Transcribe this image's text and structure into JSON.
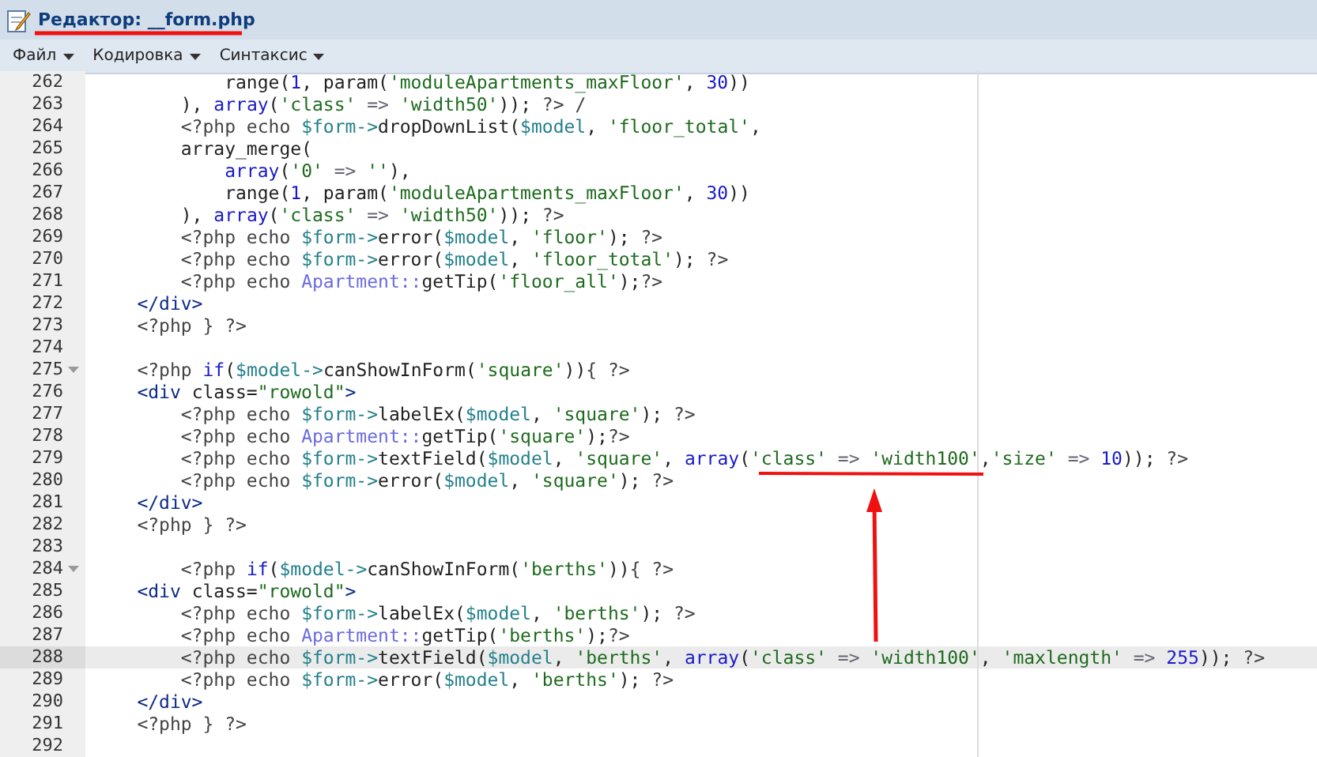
{
  "window": {
    "title": "Редактор: __form.php"
  },
  "menu": [
    {
      "label": "Файл"
    },
    {
      "label": "Кодировка"
    },
    {
      "label": "Синтаксис"
    }
  ],
  "editor": {
    "lines": [
      {
        "number": "262",
        "current": false,
        "foldable": false,
        "tokens": [
          {
            "kind": "plain",
            "text": "            range("
          },
          {
            "kind": "number",
            "text": "1"
          },
          {
            "kind": "plain",
            "text": ", param("
          },
          {
            "kind": "string",
            "text": "'moduleApartments_maxFloor'"
          },
          {
            "kind": "plain",
            "text": ", "
          },
          {
            "kind": "number",
            "text": "30"
          },
          {
            "kind": "plain",
            "text": "))"
          }
        ]
      },
      {
        "number": "263",
        "current": false,
        "foldable": false,
        "tokens": [
          {
            "kind": "plain",
            "text": "        ), "
          },
          {
            "kind": "keyword",
            "text": "array"
          },
          {
            "kind": "plain",
            "text": "("
          },
          {
            "kind": "string",
            "text": "'class'"
          },
          {
            "kind": "operator",
            "text": " => "
          },
          {
            "kind": "string",
            "text": "'width50'"
          },
          {
            "kind": "plain",
            "text": "));"
          },
          {
            "kind": "php",
            "text": " ?> /"
          }
        ]
      },
      {
        "number": "264",
        "current": false,
        "foldable": false,
        "tokens": [
          {
            "kind": "php",
            "text": "        <?php echo "
          },
          {
            "kind": "variable",
            "text": "$form->"
          },
          {
            "kind": "plain",
            "text": "dropDownList("
          },
          {
            "kind": "variable",
            "text": "$model"
          },
          {
            "kind": "plain",
            "text": ", "
          },
          {
            "kind": "string",
            "text": "'floor_total'"
          },
          {
            "kind": "plain",
            "text": ","
          }
        ]
      },
      {
        "number": "265",
        "current": false,
        "foldable": false,
        "tokens": [
          {
            "kind": "plain",
            "text": "        array_merge("
          }
        ]
      },
      {
        "number": "266",
        "current": false,
        "foldable": false,
        "tokens": [
          {
            "kind": "keyword",
            "text": "            array"
          },
          {
            "kind": "plain",
            "text": "("
          },
          {
            "kind": "string",
            "text": "'0'"
          },
          {
            "kind": "operator",
            "text": " => "
          },
          {
            "kind": "string",
            "text": "''"
          },
          {
            "kind": "plain",
            "text": "),"
          }
        ]
      },
      {
        "number": "267",
        "current": false,
        "foldable": false,
        "tokens": [
          {
            "kind": "plain",
            "text": "            range("
          },
          {
            "kind": "number",
            "text": "1"
          },
          {
            "kind": "plain",
            "text": ", param("
          },
          {
            "kind": "string",
            "text": "'moduleApartments_maxFloor'"
          },
          {
            "kind": "plain",
            "text": ", "
          },
          {
            "kind": "number",
            "text": "30"
          },
          {
            "kind": "plain",
            "text": "))"
          }
        ]
      },
      {
        "number": "268",
        "current": false,
        "foldable": false,
        "tokens": [
          {
            "kind": "plain",
            "text": "        ), "
          },
          {
            "kind": "keyword",
            "text": "array"
          },
          {
            "kind": "plain",
            "text": "("
          },
          {
            "kind": "string",
            "text": "'class'"
          },
          {
            "kind": "operator",
            "text": " => "
          },
          {
            "kind": "string",
            "text": "'width50'"
          },
          {
            "kind": "plain",
            "text": "));"
          },
          {
            "kind": "php",
            "text": " ?>"
          }
        ]
      },
      {
        "number": "269",
        "current": false,
        "foldable": false,
        "tokens": [
          {
            "kind": "php",
            "text": "        <?php echo "
          },
          {
            "kind": "variable",
            "text": "$form->"
          },
          {
            "kind": "plain",
            "text": "error("
          },
          {
            "kind": "variable",
            "text": "$model"
          },
          {
            "kind": "plain",
            "text": ", "
          },
          {
            "kind": "string",
            "text": "'floor'"
          },
          {
            "kind": "plain",
            "text": ");"
          },
          {
            "kind": "php",
            "text": " ?>"
          }
        ]
      },
      {
        "number": "270",
        "current": false,
        "foldable": false,
        "tokens": [
          {
            "kind": "php",
            "text": "        <?php echo "
          },
          {
            "kind": "variable",
            "text": "$form->"
          },
          {
            "kind": "plain",
            "text": "error("
          },
          {
            "kind": "variable",
            "text": "$model"
          },
          {
            "kind": "plain",
            "text": ", "
          },
          {
            "kind": "string",
            "text": "'floor_total'"
          },
          {
            "kind": "plain",
            "text": ");"
          },
          {
            "kind": "php",
            "text": " ?>"
          }
        ]
      },
      {
        "number": "271",
        "current": false,
        "foldable": false,
        "tokens": [
          {
            "kind": "php",
            "text": "        <?php echo "
          },
          {
            "kind": "class",
            "text": "Apartment::"
          },
          {
            "kind": "plain",
            "text": "getTip("
          },
          {
            "kind": "string",
            "text": "'floor_all'"
          },
          {
            "kind": "plain",
            "text": ");"
          },
          {
            "kind": "php",
            "text": "?>"
          }
        ]
      },
      {
        "number": "272",
        "current": false,
        "foldable": false,
        "tokens": [
          {
            "kind": "tag",
            "text": "    </div>"
          }
        ]
      },
      {
        "number": "273",
        "current": false,
        "foldable": false,
        "tokens": [
          {
            "kind": "php",
            "text": "    <?php } ?>"
          }
        ]
      },
      {
        "number": "274",
        "current": false,
        "foldable": false
      },
      {
        "number": "275",
        "current": false,
        "foldable": true,
        "tokens": [
          {
            "kind": "php",
            "text": "    <?php "
          },
          {
            "kind": "keyword",
            "text": "if"
          },
          {
            "kind": "plain",
            "text": "("
          },
          {
            "kind": "variable",
            "text": "$model->"
          },
          {
            "kind": "plain",
            "text": "canShowInForm("
          },
          {
            "kind": "string",
            "text": "'square'"
          },
          {
            "kind": "plain",
            "text": "))"
          },
          {
            "kind": "php",
            "text": "{ ?>"
          }
        ]
      },
      {
        "number": "276",
        "current": false,
        "foldable": false,
        "tokens": [
          {
            "kind": "tag",
            "text": "    <div"
          },
          {
            "kind": "plain",
            "text": " class="
          },
          {
            "kind": "string",
            "text": "\"rowold\""
          },
          {
            "kind": "tag",
            "text": ">"
          }
        ]
      },
      {
        "number": "277",
        "current": false,
        "foldable": false,
        "tokens": [
          {
            "kind": "php",
            "text": "        <?php echo "
          },
          {
            "kind": "variable",
            "text": "$form->"
          },
          {
            "kind": "plain",
            "text": "labelEx("
          },
          {
            "kind": "variable",
            "text": "$model"
          },
          {
            "kind": "plain",
            "text": ", "
          },
          {
            "kind": "string",
            "text": "'square'"
          },
          {
            "kind": "plain",
            "text": ");"
          },
          {
            "kind": "php",
            "text": " ?>"
          }
        ]
      },
      {
        "number": "278",
        "current": false,
        "foldable": false,
        "tokens": [
          {
            "kind": "php",
            "text": "        <?php echo "
          },
          {
            "kind": "class",
            "text": "Apartment::"
          },
          {
            "kind": "plain",
            "text": "getTip("
          },
          {
            "kind": "string",
            "text": "'square'"
          },
          {
            "kind": "plain",
            "text": ");"
          },
          {
            "kind": "php",
            "text": "?>"
          }
        ]
      },
      {
        "number": "279",
        "current": false,
        "foldable": false,
        "tokens": [
          {
            "kind": "php",
            "text": "        <?php echo "
          },
          {
            "kind": "variable",
            "text": "$form->"
          },
          {
            "kind": "plain",
            "text": "textField("
          },
          {
            "kind": "variable",
            "text": "$model"
          },
          {
            "kind": "plain",
            "text": ", "
          },
          {
            "kind": "string",
            "text": "'square'"
          },
          {
            "kind": "plain",
            "text": ", "
          },
          {
            "kind": "keyword",
            "text": "array"
          },
          {
            "kind": "plain",
            "text": "("
          },
          {
            "kind": "string",
            "text": "'class'"
          },
          {
            "kind": "operator",
            "text": " => "
          },
          {
            "kind": "string",
            "text": "'width100'"
          },
          {
            "kind": "plain",
            "text": ","
          },
          {
            "kind": "string",
            "text": "'size'"
          },
          {
            "kind": "operator",
            "text": " => "
          },
          {
            "kind": "number",
            "text": "10"
          },
          {
            "kind": "plain",
            "text": "));"
          },
          {
            "kind": "php",
            "text": " ?>"
          }
        ]
      },
      {
        "number": "280",
        "current": false,
        "foldable": false,
        "tokens": [
          {
            "kind": "php",
            "text": "        <?php echo "
          },
          {
            "kind": "variable",
            "text": "$form->"
          },
          {
            "kind": "plain",
            "text": "error("
          },
          {
            "kind": "variable",
            "text": "$model"
          },
          {
            "kind": "plain",
            "text": ", "
          },
          {
            "kind": "string",
            "text": "'square'"
          },
          {
            "kind": "plain",
            "text": ");"
          },
          {
            "kind": "php",
            "text": " ?>"
          }
        ]
      },
      {
        "number": "281",
        "current": false,
        "foldable": false,
        "tokens": [
          {
            "kind": "tag",
            "text": "    </div>"
          }
        ]
      },
      {
        "number": "282",
        "current": false,
        "foldable": false,
        "tokens": [
          {
            "kind": "php",
            "text": "    <?php } ?>"
          }
        ]
      },
      {
        "number": "283",
        "current": false,
        "foldable": false
      },
      {
        "number": "284",
        "current": false,
        "foldable": true,
        "tokens": [
          {
            "kind": "php",
            "text": "        <?php "
          },
          {
            "kind": "keyword",
            "text": "if"
          },
          {
            "kind": "plain",
            "text": "("
          },
          {
            "kind": "variable",
            "text": "$model->"
          },
          {
            "kind": "plain",
            "text": "canShowInForm("
          },
          {
            "kind": "string",
            "text": "'berths'"
          },
          {
            "kind": "plain",
            "text": "))"
          },
          {
            "kind": "php",
            "text": "{ ?>"
          }
        ]
      },
      {
        "number": "285",
        "current": false,
        "foldable": false,
        "tokens": [
          {
            "kind": "tag",
            "text": "    <div"
          },
          {
            "kind": "plain",
            "text": " class="
          },
          {
            "kind": "string",
            "text": "\"rowold\""
          },
          {
            "kind": "tag",
            "text": ">"
          }
        ]
      },
      {
        "number": "286",
        "current": false,
        "foldable": false,
        "tokens": [
          {
            "kind": "php",
            "text": "        <?php echo "
          },
          {
            "kind": "variable",
            "text": "$form->"
          },
          {
            "kind": "plain",
            "text": "labelEx("
          },
          {
            "kind": "variable",
            "text": "$model"
          },
          {
            "kind": "plain",
            "text": ", "
          },
          {
            "kind": "string",
            "text": "'berths'"
          },
          {
            "kind": "plain",
            "text": ");"
          },
          {
            "kind": "php",
            "text": " ?>"
          }
        ]
      },
      {
        "number": "287",
        "current": false,
        "foldable": false,
        "tokens": [
          {
            "kind": "php",
            "text": "        <?php echo "
          },
          {
            "kind": "class",
            "text": "Apartment::"
          },
          {
            "kind": "plain",
            "text": "getTip("
          },
          {
            "kind": "string",
            "text": "'berths'"
          },
          {
            "kind": "plain",
            "text": ");"
          },
          {
            "kind": "php",
            "text": "?>"
          }
        ]
      },
      {
        "number": "288",
        "current": true,
        "foldable": false,
        "tokens": [
          {
            "kind": "php",
            "text": "        <?php echo "
          },
          {
            "kind": "variable",
            "text": "$form->"
          },
          {
            "kind": "plain",
            "text": "textField("
          },
          {
            "kind": "variable",
            "text": "$model"
          },
          {
            "kind": "plain",
            "text": ", "
          },
          {
            "kind": "string",
            "text": "'berths'"
          },
          {
            "kind": "plain",
            "text": ", "
          },
          {
            "kind": "keyword",
            "text": "array"
          },
          {
            "kind": "plain",
            "text": "("
          },
          {
            "kind": "string",
            "text": "'class'"
          },
          {
            "kind": "operator",
            "text": " => "
          },
          {
            "kind": "string",
            "text": "'width100'"
          },
          {
            "kind": "plain",
            "text": ", "
          },
          {
            "kind": "string",
            "text": "'maxlength'"
          },
          {
            "kind": "operator",
            "text": " => "
          },
          {
            "kind": "number",
            "text": "255"
          },
          {
            "kind": "plain",
            "text": "));"
          },
          {
            "kind": "php",
            "text": " ?>"
          }
        ]
      },
      {
        "number": "289",
        "current": false,
        "foldable": false,
        "tokens": [
          {
            "kind": "php",
            "text": "        <?php echo "
          },
          {
            "kind": "variable",
            "text": "$form->"
          },
          {
            "kind": "plain",
            "text": "error("
          },
          {
            "kind": "variable",
            "text": "$model"
          },
          {
            "kind": "plain",
            "text": ", "
          },
          {
            "kind": "string",
            "text": "'berths'"
          },
          {
            "kind": "plain",
            "text": ");"
          },
          {
            "kind": "php",
            "text": " ?>"
          }
        ]
      },
      {
        "number": "290",
        "current": false,
        "foldable": false,
        "tokens": [
          {
            "kind": "tag",
            "text": "    </div>"
          }
        ]
      },
      {
        "number": "291",
        "current": false,
        "foldable": false,
        "tokens": [
          {
            "kind": "php",
            "text": "    <?php } ?>"
          }
        ]
      },
      {
        "number": "292",
        "current": false,
        "foldable": false
      }
    ]
  }
}
